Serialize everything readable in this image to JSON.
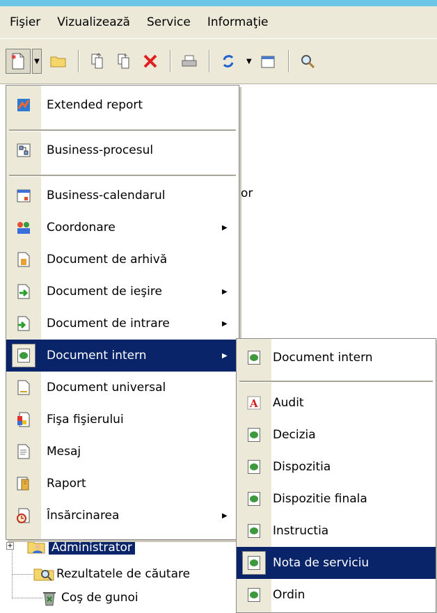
{
  "menubar": {
    "items": [
      "Fişier",
      "Vizualizează",
      "Service",
      "Informaţie"
    ]
  },
  "toolbar": {
    "icons": [
      "new-document-icon",
      "dropdown-arrow-icon",
      "open-folder-icon",
      "copy-icon",
      "paste-icon",
      "delete-icon",
      "print-icon",
      "refresh-icon",
      "dropdown-arrow-icon",
      "properties-icon",
      "search-icon"
    ]
  },
  "background": {
    "partial_text": "or"
  },
  "tree": {
    "items": [
      {
        "label": "Administrator",
        "selected": true,
        "icon": "user-folder-icon"
      },
      {
        "label": "Rezultatele de căutare",
        "icon": "search-folder-icon"
      },
      {
        "label": "Coş de gunoi",
        "icon": "recycle-bin-icon"
      }
    ]
  },
  "menu": {
    "items": [
      {
        "label": "Extended report",
        "icon": "extended-report-icon",
        "submenu": false
      },
      {
        "label": "Business-procesul",
        "icon": "business-process-icon",
        "submenu": false
      },
      {
        "label": "Business-calendarul",
        "icon": "calendar-icon",
        "submenu": false
      },
      {
        "label": "Coordonare",
        "icon": "coordination-icon",
        "submenu": true
      },
      {
        "label": "Document de arhivă",
        "icon": "archive-document-icon",
        "submenu": false
      },
      {
        "label": "Document de ieşire",
        "icon": "outgoing-document-icon",
        "submenu": true
      },
      {
        "label": "Document de intrare",
        "icon": "incoming-document-icon",
        "submenu": true
      },
      {
        "label": "Document intern",
        "icon": "internal-document-icon",
        "submenu": true,
        "highlighted": true
      },
      {
        "label": "Document universal",
        "icon": "universal-document-icon",
        "submenu": false
      },
      {
        "label": "Fişa fişierului",
        "icon": "file-card-icon",
        "submenu": false
      },
      {
        "label": "Mesaj",
        "icon": "message-icon",
        "submenu": false
      },
      {
        "label": "Raport",
        "icon": "report-icon",
        "submenu": false
      },
      {
        "label": "Însărcinarea",
        "icon": "task-icon",
        "submenu": true
      }
    ]
  },
  "submenu": {
    "items": [
      {
        "label": "Document intern",
        "icon": "internal-document-icon"
      },
      {
        "label": "Audit",
        "icon": "audit-icon"
      },
      {
        "label": "Decizia",
        "icon": "internal-document-icon"
      },
      {
        "label": "Dispozitia",
        "icon": "internal-document-icon"
      },
      {
        "label": "Dispozitie finala",
        "icon": "internal-document-icon"
      },
      {
        "label": "Instructia",
        "icon": "internal-document-icon"
      },
      {
        "label": "Nota de serviciu",
        "icon": "internal-document-icon",
        "highlighted": true
      },
      {
        "label": "Ordin",
        "icon": "internal-document-icon"
      }
    ]
  },
  "colors": {
    "highlight": "#0a246a",
    "menu_gutter": "#ece9d8",
    "top_accent": "#6ec6e6"
  }
}
